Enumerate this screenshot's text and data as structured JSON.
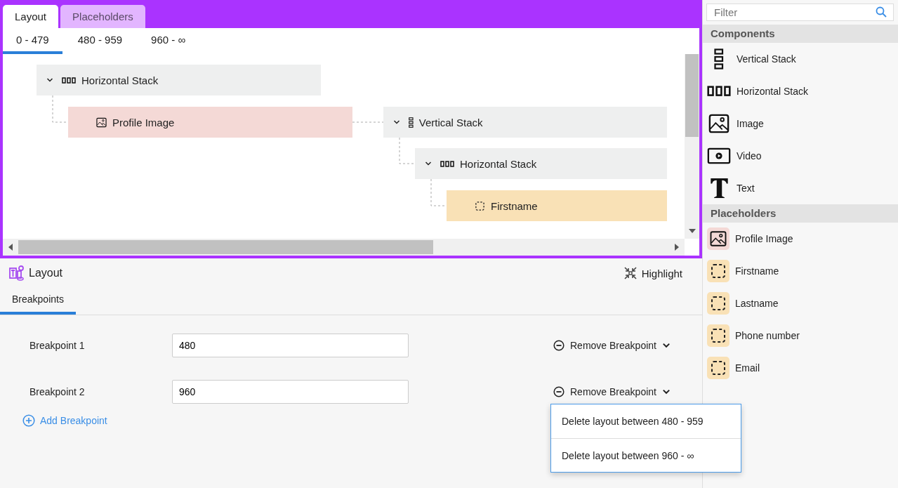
{
  "tabs": [
    {
      "label": "Layout",
      "selected": true
    },
    {
      "label": "Placeholders",
      "selected": false
    }
  ],
  "breakpoint_tabs": [
    {
      "label": "0 - 479",
      "selected": true
    },
    {
      "label": "480 - 959",
      "selected": false
    },
    {
      "label": "960 - ∞",
      "selected": false
    }
  ],
  "tree": [
    {
      "kind": "hstack",
      "label": "Horizontal Stack",
      "expanded": true,
      "children": [
        {
          "kind": "image",
          "label": "Profile Image"
        },
        {
          "kind": "vstack",
          "label": "Vertical Stack",
          "expanded": true,
          "children": [
            {
              "kind": "hstack",
              "label": "Horizontal Stack",
              "expanded": true,
              "children": [
                {
                  "kind": "placeholder",
                  "label": "Firstname"
                }
              ]
            }
          ]
        }
      ]
    }
  ],
  "layout_panel": {
    "title": "Layout",
    "highlight_button": "Highlight",
    "tabs": [
      {
        "label": "Breakpoints",
        "selected": true
      }
    ],
    "breakpoints": [
      {
        "label": "Breakpoint 1",
        "value": "480",
        "remove_button": "Remove Breakpoint"
      },
      {
        "label": "Breakpoint 2",
        "value": "960",
        "remove_button": "Remove Breakpoint"
      }
    ],
    "add_button": "Add Breakpoint",
    "menu": [
      "Delete layout between 480 - 959",
      "Delete layout between 960 - ∞"
    ]
  },
  "sidebar": {
    "filter_placeholder": "Filter",
    "sections": [
      {
        "kind": "components",
        "title": "Components",
        "items": [
          {
            "kind": "vstack",
            "label": "Vertical Stack"
          },
          {
            "kind": "hstack",
            "label": "Horizontal Stack"
          },
          {
            "kind": "image",
            "label": "Image"
          },
          {
            "kind": "video",
            "label": "Video"
          },
          {
            "kind": "text",
            "label": "Text"
          }
        ]
      },
      {
        "kind": "placeholders",
        "title": "Placeholders",
        "items": [
          {
            "kind": "image",
            "label": "Profile Image"
          },
          {
            "kind": "placeholder",
            "label": "Firstname"
          },
          {
            "kind": "placeholder",
            "label": "Lastname"
          },
          {
            "kind": "placeholder",
            "label": "Phone number"
          },
          {
            "kind": "placeholder",
            "label": "Email"
          }
        ]
      }
    ]
  }
}
